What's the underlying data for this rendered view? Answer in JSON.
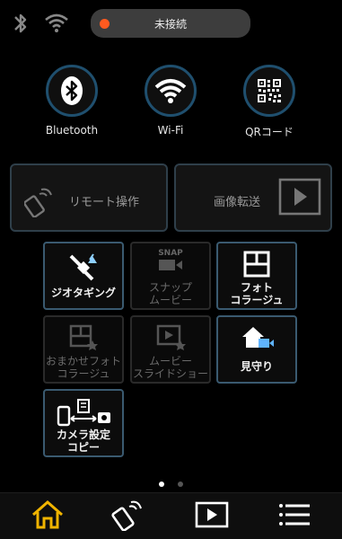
{
  "status": {
    "connection_label": "未接続",
    "connection_color": "#ff5a1f"
  },
  "top_buttons": [
    {
      "label": "Bluetooth",
      "icon": "bluetooth-icon"
    },
    {
      "label": "Wi-Fi",
      "icon": "wifi-icon"
    },
    {
      "label": "QRコード",
      "icon": "qr-code-icon"
    }
  ],
  "big_buttons": {
    "remote": "リモート操作",
    "transfer": "画像転送"
  },
  "tiles": [
    {
      "label": "ジオタギング",
      "enabled": true
    },
    {
      "label": "スナップ\nムービー",
      "enabled": false,
      "icon_text": "SNAP"
    },
    {
      "label": "フォト\nコラージュ",
      "enabled": true
    },
    {
      "label": "おまかせフォト\nコラージュ",
      "enabled": false
    },
    {
      "label": "ムービー\nスライドショー",
      "enabled": false
    },
    {
      "label": "見守り",
      "enabled": true
    },
    {
      "label": "カメラ設定\nコピー",
      "enabled": true
    }
  ],
  "page_indicator": {
    "current": 1,
    "total": 2
  },
  "bottom_nav": [
    "home-icon",
    "remote-icon",
    "playback-icon",
    "menu-icon"
  ],
  "accent_color": "#f0b400"
}
